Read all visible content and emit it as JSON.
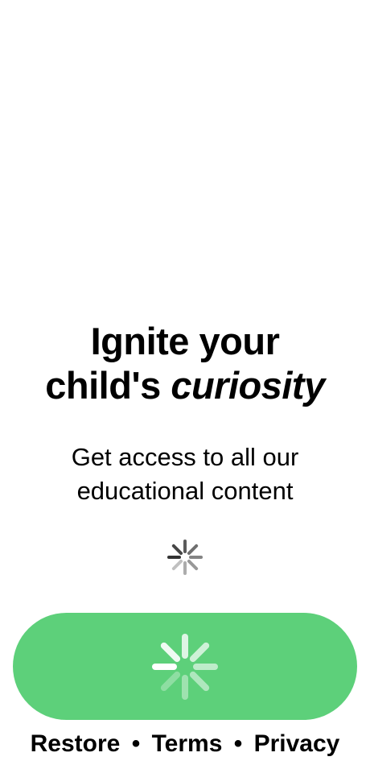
{
  "headline": {
    "line1": "Ignite your",
    "line2_prefix": "child's ",
    "line2_accent": "curiosity"
  },
  "subtitle": {
    "line1": "Get access to all our",
    "line2": "educational content"
  },
  "loading_indicator": {
    "icon": "activity-spinner-icon",
    "color": "#333333"
  },
  "cta_button": {
    "color": "#5dd07a",
    "icon": "activity-spinner-icon",
    "spinner_color": "#ffffff"
  },
  "footer": {
    "restore": "Restore",
    "separator": "•",
    "terms": "Terms",
    "privacy": "Privacy"
  }
}
